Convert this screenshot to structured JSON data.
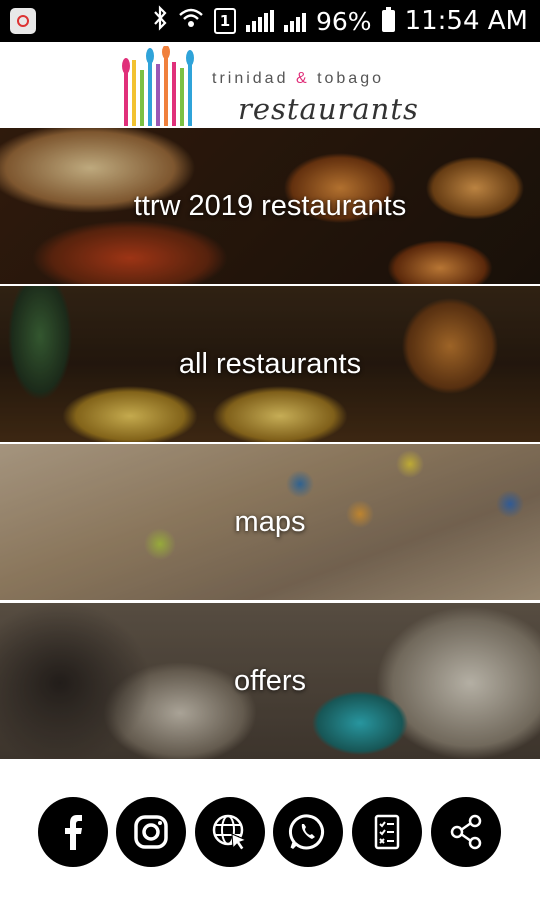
{
  "status_bar": {
    "battery": "96%",
    "time": "11:54 AM",
    "sim_label": "1",
    "icons": [
      "app-icon",
      "bluetooth-icon",
      "wifi-icon",
      "sim-icon",
      "signal-icon",
      "signal-icon",
      "battery-icon"
    ]
  },
  "header": {
    "brand_line1_left": "trinidad",
    "brand_amp": "&",
    "brand_line1_right": "tobago",
    "brand_line2": "restaurants",
    "logo_colors": [
      "#e0307a",
      "#f2c230",
      "#7bc043",
      "#2fa3d9",
      "#9b59b6",
      "#f0803c"
    ]
  },
  "tiles": [
    {
      "label": "ttrw 2019 restaurants"
    },
    {
      "label": "all restaurants"
    },
    {
      "label": "maps"
    },
    {
      "label": "offers"
    }
  ],
  "social": [
    "facebook-icon",
    "instagram-icon",
    "website-icon",
    "whatsapp-icon",
    "checklist-icon",
    "share-icon"
  ]
}
